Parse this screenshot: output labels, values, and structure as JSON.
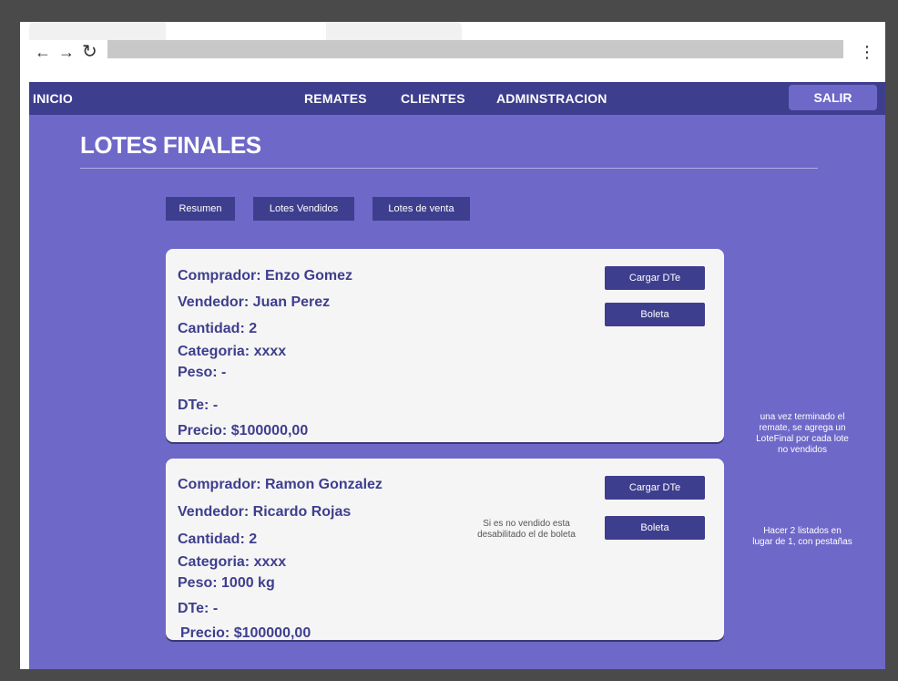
{
  "nav": {
    "home": "INICIO",
    "auctions": "REMATES",
    "clients": "CLIENTES",
    "admin": "ADMINSTRACION",
    "logout": "SALIR"
  },
  "page": {
    "title": "LOTES FINALES"
  },
  "tabs": [
    {
      "label": "Resumen"
    },
    {
      "label": "Lotes Vendidos"
    },
    {
      "label": "Lotes de venta"
    }
  ],
  "cards": [
    {
      "buyer": "Comprador: Enzo Gomez",
      "seller": "Vendedor: Juan Perez",
      "quantity": "Cantidad: 2",
      "category": "Categoria: xxxx",
      "weight": "Peso: -",
      "dte": "DTe: -",
      "price": "Precio: $100000,00",
      "upload_dte_label": "Cargar DTe",
      "receipt_label": "Boleta"
    },
    {
      "buyer": "Comprador: Ramon Gonzalez",
      "seller": "Vendedor: Ricardo Rojas",
      "quantity": "Cantidad: 2",
      "category": "Categoria: xxxx",
      "weight": "Peso: 1000 kg",
      "dte": "DTe: -",
      "price": "Precio: $100000,00",
      "upload_dte_label": "Cargar DTe",
      "receipt_label": "Boleta",
      "note_line1": "Si es no vendido esta",
      "note_line2": "desabilitado el de boleta"
    }
  ],
  "annotations": {
    "note1": [
      "una vez terminado el",
      "remate, se agrega un",
      "LoteFinal por cada lote",
      "no vendidos"
    ],
    "note2": [
      "Hacer 2 listados en",
      "lugar de 1, con pestañas"
    ]
  },
  "colors": {
    "navbar": "#3e3e8f",
    "content_bg": "#6e68c8",
    "card_bg": "#f5f5f5",
    "button": "#3e3e8f"
  }
}
